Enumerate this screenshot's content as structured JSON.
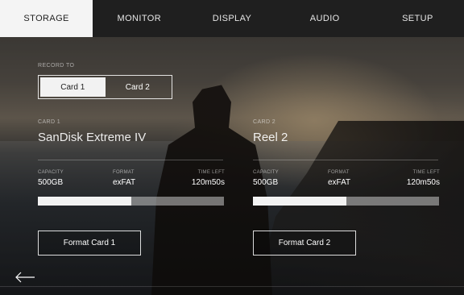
{
  "tabs": [
    {
      "label": "STORAGE",
      "active": true
    },
    {
      "label": "MONITOR",
      "active": false
    },
    {
      "label": "DISPLAY",
      "active": false
    },
    {
      "label": "AUDIO",
      "active": false
    },
    {
      "label": "SETUP",
      "active": false
    }
  ],
  "record_to": {
    "label": "RECORD TO",
    "options": [
      "Card 1",
      "Card 2"
    ],
    "selected": "Card 1"
  },
  "cards": [
    {
      "tag": "CARD 1",
      "name": "SanDisk Extreme IV",
      "capacity_label": "CAPACITY",
      "capacity": "500GB",
      "format_label": "FORMAT",
      "format": "exFAT",
      "time_left_label": "TIME LEFT",
      "time_left": "120m50s",
      "fill_fraction": 0.5,
      "button": "Format Card 1"
    },
    {
      "tag": "CARD 2",
      "name": "Reel 2",
      "capacity_label": "CAPACITY",
      "capacity": "500GB",
      "format_label": "FORMAT",
      "format": "exFAT",
      "time_left_label": "TIME LEFT",
      "time_left": "120m50s",
      "fill_fraction": 0.5,
      "button": "Format Card 2"
    }
  ],
  "icons": {
    "back": "back-arrow-icon"
  },
  "colors": {
    "tab_active_bg": "#f4f4f4",
    "tab_bar_bg": "#1f1f1f",
    "bar_fill": "#f2f2f2"
  }
}
